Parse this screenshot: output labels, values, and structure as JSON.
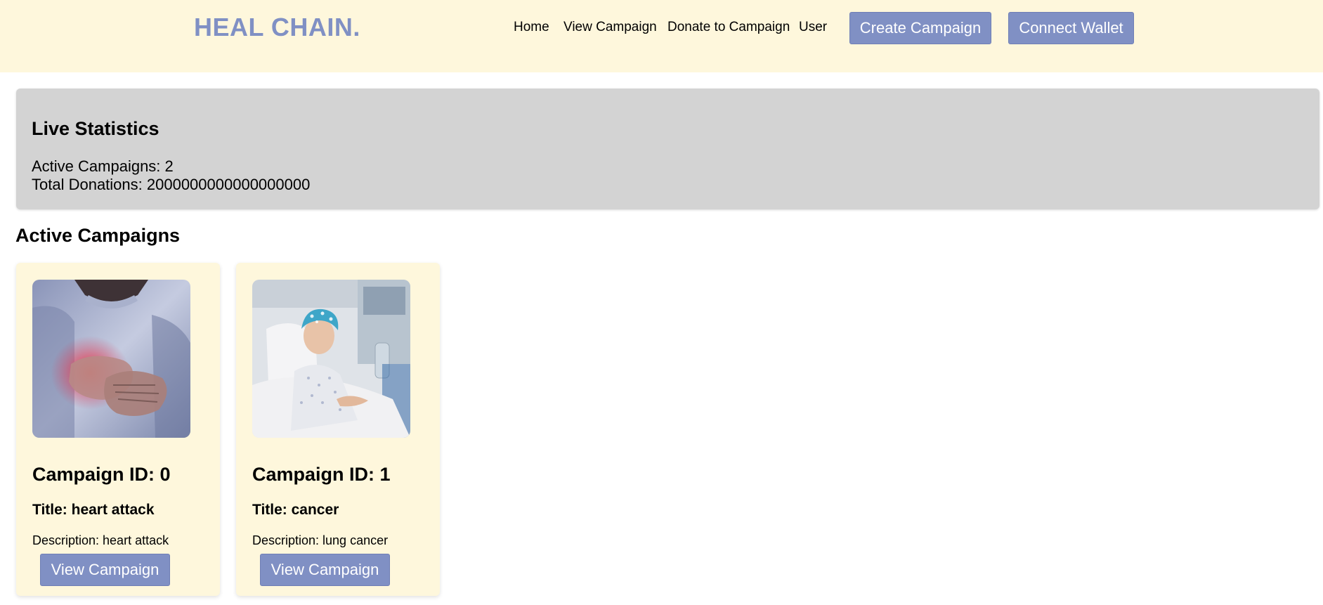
{
  "header": {
    "brand": "HEAL CHAIN.",
    "nav": [
      "Home",
      "View Campaign",
      "Donate to Campaign",
      "User"
    ],
    "create_button": "Create Campaign",
    "connect_button": "Connect Wallet"
  },
  "stats": {
    "title": "Live Statistics",
    "active_campaigns": "Active Campaigns: 2",
    "total_donations": "Total Donations: 2000000000000000000"
  },
  "campaigns_section": {
    "title": "Active Campaigns"
  },
  "campaigns": [
    {
      "id_label": "Campaign ID: 0",
      "title_label": "Title: heart attack",
      "desc_label": "Description: heart attack",
      "button": "View Campaign",
      "image_icon": "heart-attack-photo"
    },
    {
      "id_label": "Campaign ID: 1",
      "title_label": "Title: cancer",
      "desc_label": "Description: lung cancer",
      "button": "View Campaign",
      "image_icon": "cancer-patient-photo"
    }
  ],
  "colors": {
    "header_bg": "#fef7dc",
    "accent": "#8090c4",
    "stats_bg": "#d3d3d3"
  }
}
